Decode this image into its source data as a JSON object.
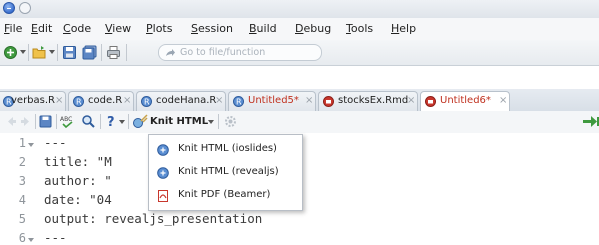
{
  "menubar": {
    "items": [
      {
        "underline": "F",
        "rest": "ile"
      },
      {
        "underline": "E",
        "rest": "dit"
      },
      {
        "underline": "C",
        "rest": "ode"
      },
      {
        "underline": "V",
        "rest": "iew"
      },
      {
        "underline": "P",
        "rest": "lots"
      },
      {
        "underline": "S",
        "rest": "ession"
      },
      {
        "underline": "B",
        "rest": "uild"
      },
      {
        "underline": "D",
        "rest": "ebug"
      },
      {
        "underline": "T",
        "rest": "ools"
      },
      {
        "underline": "H",
        "rest": "elp"
      }
    ]
  },
  "toolbar": {
    "goto_placeholder": "Go to file/function"
  },
  "tabs": [
    {
      "label": "verbas.R",
      "close": "×"
    },
    {
      "label": "code.R",
      "close": "×"
    },
    {
      "label": "codeHana.R",
      "close": "×"
    },
    {
      "label": "Untitled5*",
      "close": "×"
    },
    {
      "label": "stocksEx.Rmd",
      "close": "×"
    },
    {
      "label": "Untitled6*",
      "close": "×"
    }
  ],
  "editor_toolbar": {
    "knit_label": "Knit HTML",
    "knit_arrow": "▾"
  },
  "editor": {
    "line_numbers": [
      "1",
      "2",
      "3",
      "4",
      "5",
      "6"
    ],
    "lines": [
      "---",
      "title: \"M",
      "author: \"",
      "date: \"04",
      "output: revealjs_presentation",
      "---"
    ]
  },
  "knit_menu": {
    "items": [
      {
        "label": "Knit HTML (ioslides)"
      },
      {
        "label": "Knit HTML (revealjs)"
      },
      {
        "label": "Knit PDF (Beamer)"
      }
    ]
  },
  "colors": {
    "dirty_tab_text": "#c0311f",
    "accent_blue": "#3a6fcf"
  }
}
